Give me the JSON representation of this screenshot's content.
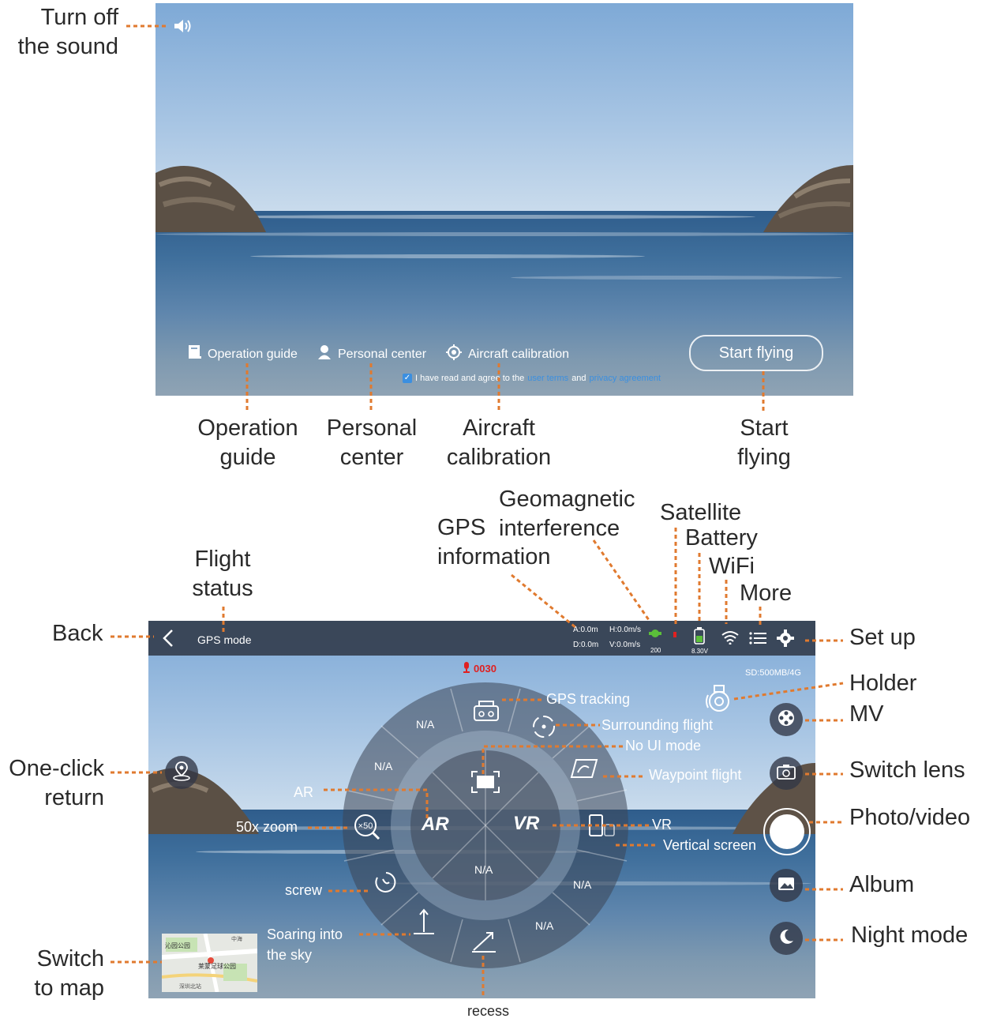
{
  "annotations": {
    "turn_off_sound": "Turn off\nthe sound",
    "operation_guide": "Operation\nguide",
    "personal_center": "Personal\ncenter",
    "aircraft_calibration": "Aircraft\ncalibration",
    "start_flying": "Start\nflying",
    "gps_information": "GPS\ninformation",
    "geomagnetic_interference": "Geomagnetic\ninterference",
    "satellite": "Satellite",
    "battery": "Battery",
    "wifi": "WiFi",
    "more": "More",
    "flight_status": "Flight\nstatus",
    "back": "Back",
    "set_up": "Set up",
    "holder": "Holder",
    "mv": "MV",
    "one_click_return": "One-click\nreturn",
    "switch_lens": "Switch lens",
    "photo_video": "Photo/video",
    "album": "Album",
    "night_mode": "Night mode",
    "switch_to_map": "Switch\nto map",
    "recess": "recess"
  },
  "home_screen": {
    "operation_guide": "Operation guide",
    "personal_center": "Personal center",
    "aircraft_calibration": "Aircraft calibration",
    "start_flying": "Start flying",
    "agree_prefix": "I have read and agree to the",
    "user_terms": "user terms",
    "and": "and",
    "privacy_agreement": "privacy agreement"
  },
  "flight_screen": {
    "mode": "GPS mode",
    "altitude": "A:0.0m",
    "distance": "D:0.0m",
    "h_speed": "H:0.0m/s",
    "v_speed": "V:0.0m/s",
    "gps_count": "200",
    "battery_voltage": "8.30V",
    "record_time": "0030",
    "sd_info": "SD:500MB/4G",
    "menu": {
      "gps_tracking": "GPS tracking",
      "surrounding_flight": "Surrounding flight",
      "no_ui_mode": "No UI mode",
      "waypoint_flight": "Waypoint flight",
      "ar": "AR",
      "vr": "VR",
      "zoom": "50x zoom",
      "zoom_badge": "×50",
      "vertical_screen": "Vertical screen",
      "screw": "screw",
      "soaring": "Soaring into\nthe sky",
      "na": "N/A"
    },
    "map": {
      "place1": "沁园公园",
      "place2": "中海",
      "place3": "莱蒙足球公园",
      "place4": "深圳北站"
    }
  },
  "colors": {
    "annotation_line": "#e07a2f",
    "link": "#3b8fe0",
    "record_red": "#e02020",
    "gps_green": "#5bbf3a"
  },
  "icons": [
    "speaker-icon",
    "book-icon",
    "person-icon",
    "crosshair-icon",
    "checkbox-icon",
    "back-arrow-icon",
    "satellite-icon",
    "battery-icon",
    "wifi-icon",
    "menu-icon",
    "gear-icon",
    "gimbal-icon",
    "film-reel-icon",
    "camera-switch-icon",
    "shutter-icon",
    "album-icon",
    "moon-icon",
    "return-home-icon",
    "mic-icon",
    "remote-icon",
    "orbit-icon",
    "fullscreen-icon",
    "waypoint-icon",
    "zoom-icon",
    "phone-rotate-icon",
    "spiral-icon",
    "rise-icon",
    "diagonal-icon"
  ]
}
